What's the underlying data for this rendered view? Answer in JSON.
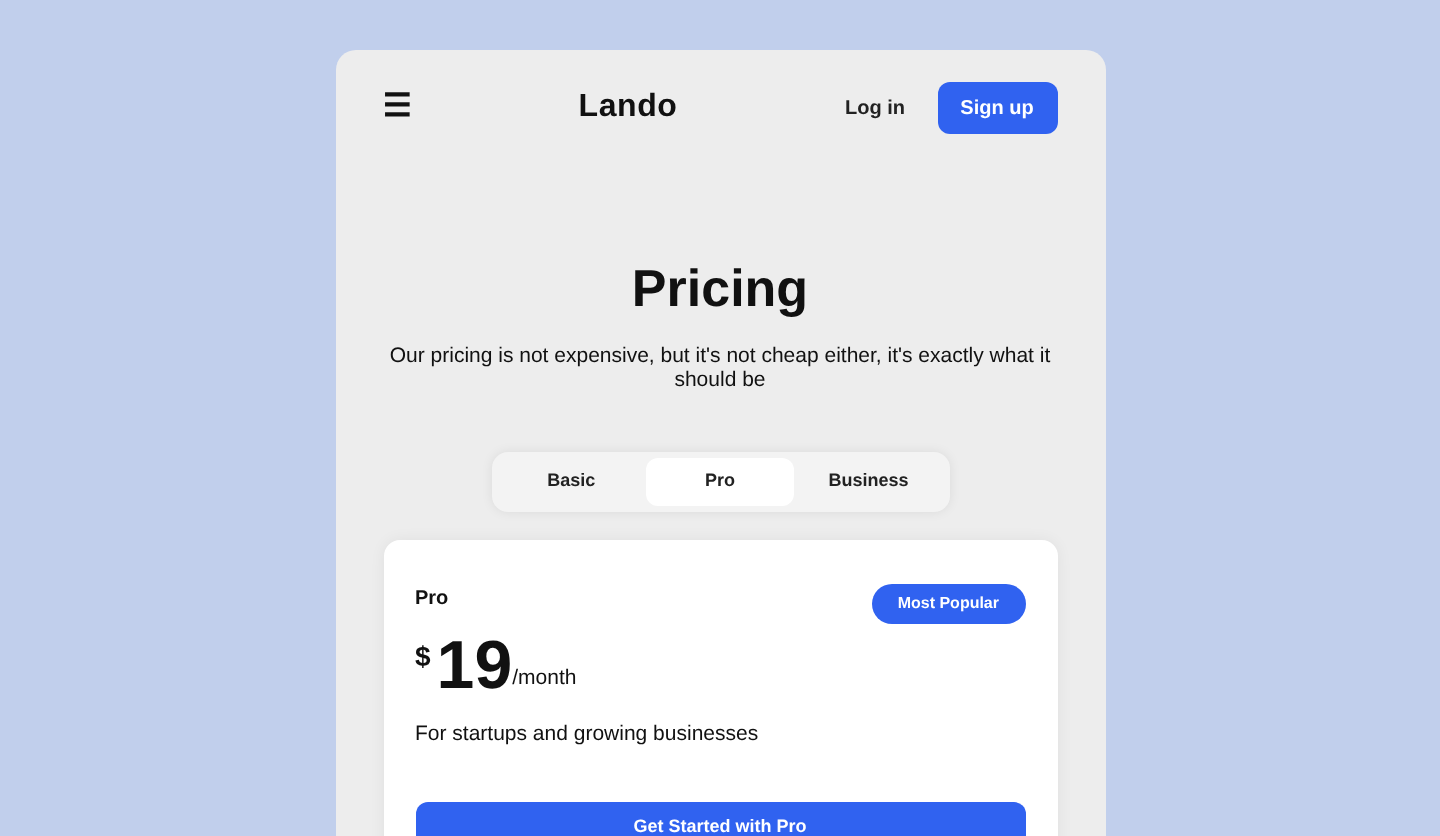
{
  "header": {
    "menu_icon": "☰",
    "logo": "Lando",
    "login": "Log in",
    "signup": "Sign up"
  },
  "title": "Pricing",
  "subtitle": "Our pricing is not expensive, but it's not cheap either, it's exactly what it should be",
  "tabs": [
    {
      "label": "Basic",
      "selected": false
    },
    {
      "label": "Pro",
      "selected": true
    },
    {
      "label": "Business",
      "selected": false
    }
  ],
  "plan": {
    "name": "Pro",
    "badge": "Most Popular",
    "currency": "$",
    "price": "19",
    "period": "/month",
    "description": "For startups and growing businesses",
    "cta": "Get Started with Pro"
  }
}
